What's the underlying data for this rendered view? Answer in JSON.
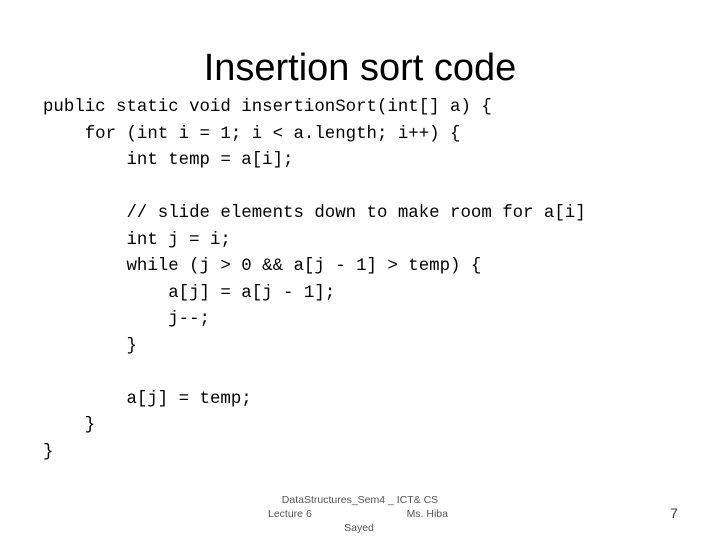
{
  "slide": {
    "title": "Insertion sort code",
    "code_lines": [
      "public static void insertionSort(int[] a) {",
      "    for (int i = 1; i < a.length; i++) {",
      "        int temp = a[i];",
      "",
      "        // slide elements down to make room for a[i]",
      "        int j = i;",
      "        while (j > 0 && a[j - 1] > temp) {",
      "            a[j] = a[j - 1];",
      "            j--;",
      "        }",
      "",
      "        a[j] = temp;",
      "    }",
      "}"
    ],
    "footer": {
      "course": "DataStructures_Sem4 _ ICT& CS",
      "lecture": "Lecture 6",
      "instructor_first": "Ms. Hiba",
      "instructor_last": "Sayed"
    },
    "slide_number": "7"
  }
}
